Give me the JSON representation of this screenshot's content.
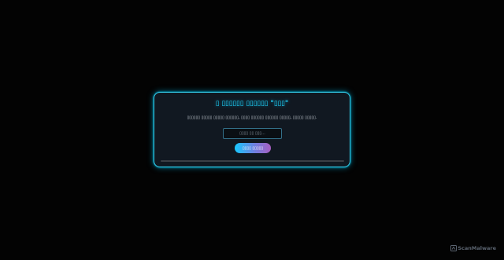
{
  "dialog": {
    "title": "\"▯▯▯\" ▯▯▯▯▯▯ ▯▯▯▯▯▯ ▯",
    "subtitle": ".▯▯▯▯▯ ▯▯▯▯▯ ,▯▯▯▯▯ ▯▯▯▯▯▯ ▯▯▯▯▯▯ ▯▯▯▯ ,▯▯▯▯▯▯ ▯▯▯▯▯ ▯▯▯▯▯ ▯▯▯▯▯▯",
    "input_placeholder": "...▯▯▯ ▯▯ ▯▯▯▯",
    "input_value": "",
    "button_label": "▯▯▯▯▯ ▯▯▯▯",
    "progress": 0
  },
  "watermark": {
    "text": "ScanMalware",
    "icon": "scanmalware-logo-icon"
  },
  "colors": {
    "background": "#030303",
    "card_background": "#111821",
    "accent": "#20d8ff",
    "button_start": "#17c9ff",
    "button_end": "#a85fc0"
  }
}
